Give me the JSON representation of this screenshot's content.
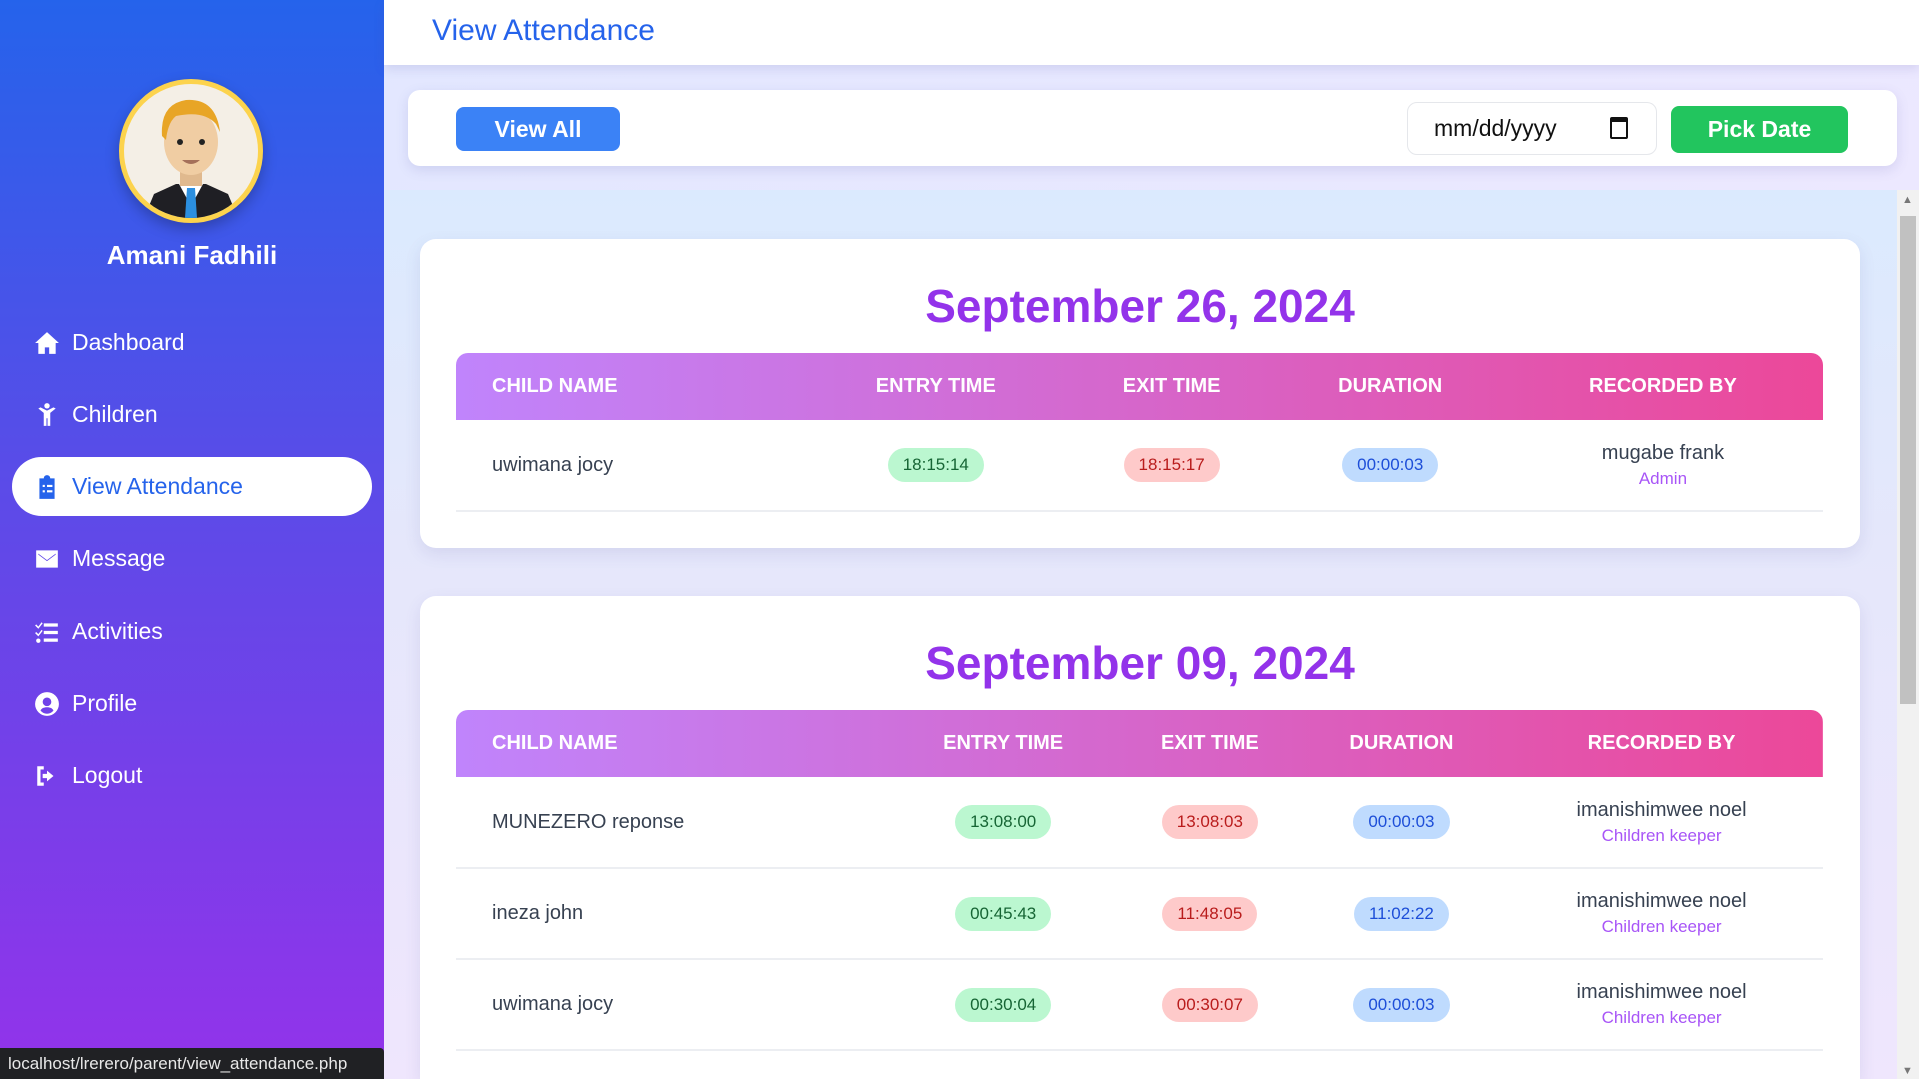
{
  "sidebar": {
    "user_name": "Amani Fadhili",
    "items": [
      {
        "label": "Dashboard",
        "icon": "home-icon"
      },
      {
        "label": "Children",
        "icon": "child-icon"
      },
      {
        "label": "View Attendance",
        "icon": "clipboard-icon",
        "active": true
      },
      {
        "label": "Message",
        "icon": "envelope-icon"
      },
      {
        "label": "Activities",
        "icon": "tasks-icon"
      },
      {
        "label": "Profile",
        "icon": "user-circle-icon"
      },
      {
        "label": "Logout",
        "icon": "logout-icon"
      }
    ]
  },
  "header": {
    "title": "View Attendance"
  },
  "toolbar": {
    "view_all": "View All",
    "date_placeholder": "mm/dd/yyyy",
    "pick_date": "Pick Date"
  },
  "columns": [
    "CHILD NAME",
    "ENTRY TIME",
    "EXIT TIME",
    "DURATION",
    "RECORDED BY"
  ],
  "groups": [
    {
      "date": "September 26, 2024",
      "rows": [
        {
          "child": "uwimana jocy",
          "entry": "18:15:14",
          "exit": "18:15:17",
          "duration": "00:00:03",
          "recorder": "mugabe frank",
          "role": "Admin"
        }
      ]
    },
    {
      "date": "September 09, 2024",
      "rows": [
        {
          "child": "MUNEZERO reponse",
          "entry": "13:08:00",
          "exit": "13:08:03",
          "duration": "00:00:03",
          "recorder": "imanishimwee noel",
          "role": "Children keeper"
        },
        {
          "child": "ineza john",
          "entry": "00:45:43",
          "exit": "11:48:05",
          "duration": "11:02:22",
          "recorder": "imanishimwee noel",
          "role": "Children keeper"
        },
        {
          "child": "uwimana jocy",
          "entry": "00:30:04",
          "exit": "00:30:07",
          "duration": "00:00:03",
          "recorder": "imanishimwee noel",
          "role": "Children keeper"
        }
      ]
    }
  ],
  "status_url": "localhost/lrerero/parent/view_attendance.php"
}
